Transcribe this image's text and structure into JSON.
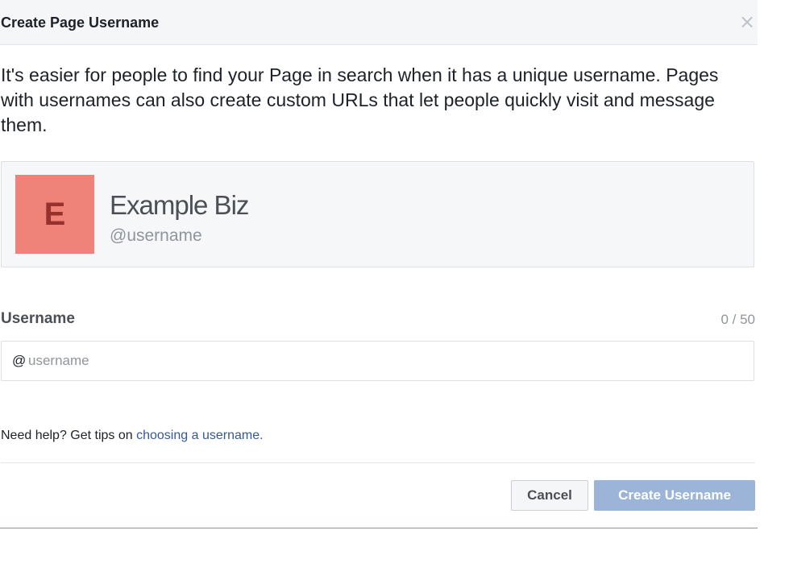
{
  "dialog": {
    "title": "Create Page Username",
    "close_symbol": "×",
    "description": "It's easier for people to find your Page in search when it has a unique username. Pages with usernames can also create custom URLs that let people quickly visit and message them."
  },
  "preview": {
    "avatar_letter": "E",
    "avatar_color": "#f08379",
    "avatar_letter_color": "#97312e",
    "page_name": "Example Biz",
    "handle": "@username"
  },
  "username_field": {
    "label": "Username",
    "char_count": "0 / 50",
    "prefix": "@",
    "value": "",
    "placeholder": "username"
  },
  "help": {
    "text": "Need help? Get tips on ",
    "link_text": "choosing a username."
  },
  "actions": {
    "cancel_label": "Cancel",
    "create_label": "Create Username"
  },
  "colors": {
    "link": "#365899",
    "primary_disabled": "#9cb4d8"
  },
  "icons": {
    "close": "close-icon"
  }
}
